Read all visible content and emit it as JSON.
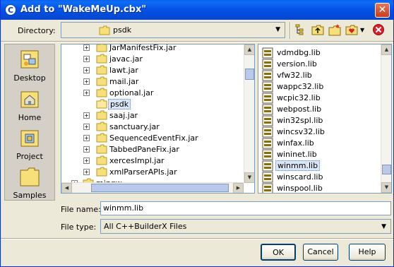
{
  "window": {
    "title": "Add to \"WakeMeUp.cbx\""
  },
  "directory": {
    "label": "Directory:",
    "value": "psdk"
  },
  "places": [
    {
      "label": "Desktop"
    },
    {
      "label": "Home"
    },
    {
      "label": "Project"
    },
    {
      "label": "Samples"
    }
  ],
  "tree": {
    "items": [
      {
        "label": "JarManifestFix.jar"
      },
      {
        "label": "javac.jar"
      },
      {
        "label": "lawt.jar"
      },
      {
        "label": "mail.jar"
      },
      {
        "label": "optional.jar"
      },
      {
        "label": "psdk"
      },
      {
        "label": "saaj.jar"
      },
      {
        "label": "sanctuary.jar"
      },
      {
        "label": "SequencedEventFix.jar"
      },
      {
        "label": "TabbedPaneFix.jar"
      },
      {
        "label": "xercesImpl.jar"
      },
      {
        "label": "xmlParserAPIs.jar"
      },
      {
        "label": "mingw"
      }
    ],
    "selected": "psdk"
  },
  "files": {
    "items": [
      {
        "label": "vdmdbg.lib"
      },
      {
        "label": "version.lib"
      },
      {
        "label": "vfw32.lib"
      },
      {
        "label": "wappc32.lib"
      },
      {
        "label": "wcpic32.lib"
      },
      {
        "label": "webpost.lib"
      },
      {
        "label": "win32spl.lib"
      },
      {
        "label": "wincsv32.lib"
      },
      {
        "label": "winfax.lib"
      },
      {
        "label": "wininet.lib"
      },
      {
        "label": "winmm.lib"
      },
      {
        "label": "winscard.lib"
      },
      {
        "label": "winspool.lib"
      }
    ],
    "selected": "winmm.lib"
  },
  "file_name": {
    "label": "File name:",
    "value": "winmm.lib"
  },
  "file_type": {
    "label": "File type:",
    "value": "All C++BuilderX Files"
  },
  "buttons": {
    "ok": "OK",
    "cancel": "Cancel",
    "help": "Help"
  },
  "colors": {
    "title_bar": "#0553e8",
    "selection": "#dbe6f5",
    "dialog_bg": "#ece9d8"
  }
}
